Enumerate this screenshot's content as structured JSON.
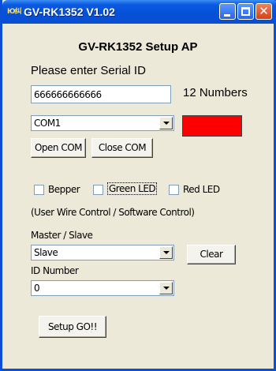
{
  "window": {
    "app_icon_text": "Ю纠",
    "title": "GV-RK1352 V1.02"
  },
  "form": {
    "heading": "GV-RK1352 Setup AP",
    "serial_prompt": "Please enter Serial ID",
    "serial_value": "666666666666",
    "serial_hint": "12 Numbers",
    "com_port": {
      "selected": "COM1"
    },
    "open_com_label": "Open COM",
    "close_com_label": "Close COM",
    "status_color": "#ff0000",
    "checkboxes": [
      {
        "label": "Bepper",
        "checked": false
      },
      {
        "label": "Green LED",
        "checked": false
      },
      {
        "label": "Red LED",
        "checked": false
      }
    ],
    "control_note": "(User Wire Control / Software Control)",
    "master_slave_label": "Master / Slave",
    "master_slave": {
      "selected": "Slave"
    },
    "clear_label": "Clear",
    "id_number_label": "ID Number",
    "id_number": {
      "selected": "0"
    },
    "setup_go_label": "Setup GO!!"
  },
  "icons": {
    "minimize": "minimize-icon",
    "maximize": "maximize-icon",
    "close": "close-icon",
    "dropdown": "chevron-down-icon"
  }
}
